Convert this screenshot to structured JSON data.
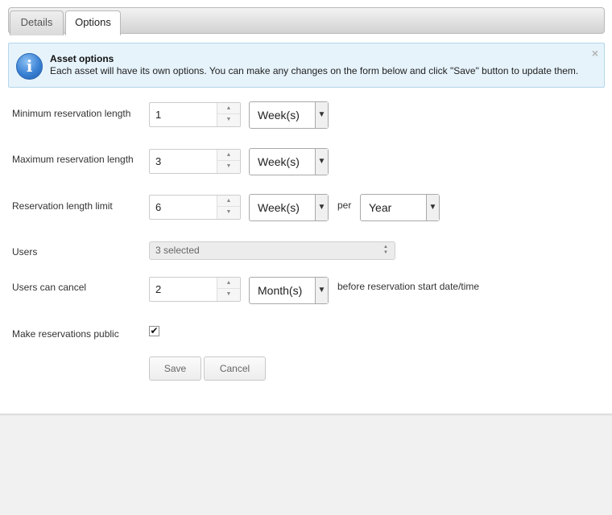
{
  "tabs": [
    {
      "label": "Details"
    },
    {
      "label": "Options"
    }
  ],
  "info": {
    "icon": "info-icon",
    "title": "Asset options",
    "text": "Each asset will have its own options. You can make any changes on the form below and click \"Save\" button to update them.",
    "close": "×"
  },
  "form": {
    "min_length": {
      "label": "Minimum reservation length",
      "value": "1",
      "unit": "Week(s)"
    },
    "max_length": {
      "label": "Maximum reservation length",
      "value": "3",
      "unit": "Week(s)"
    },
    "length_limit": {
      "label": "Reservation length limit",
      "value": "6",
      "unit": "Week(s)",
      "per_label": "per",
      "per_value": "Year"
    },
    "users": {
      "label": "Users",
      "value": "3 selected"
    },
    "cancel": {
      "label": "Users can cancel",
      "value": "2",
      "unit": "Month(s)",
      "suffix": "before reservation start date/time"
    },
    "public": {
      "label": "Make reservations public",
      "checked": true,
      "mark": "✔"
    }
  },
  "buttons": {
    "save": "Save",
    "cancel": "Cancel"
  },
  "glyphs": {
    "up": "▲",
    "down": "▼",
    "select_arrow": "▼",
    "updown_up": "▲",
    "updown_down": "▼"
  },
  "colors": {
    "info_bg": "#e6f3fb",
    "info_border": "#b5d6ea",
    "icon_blue": "#3b82d4"
  }
}
